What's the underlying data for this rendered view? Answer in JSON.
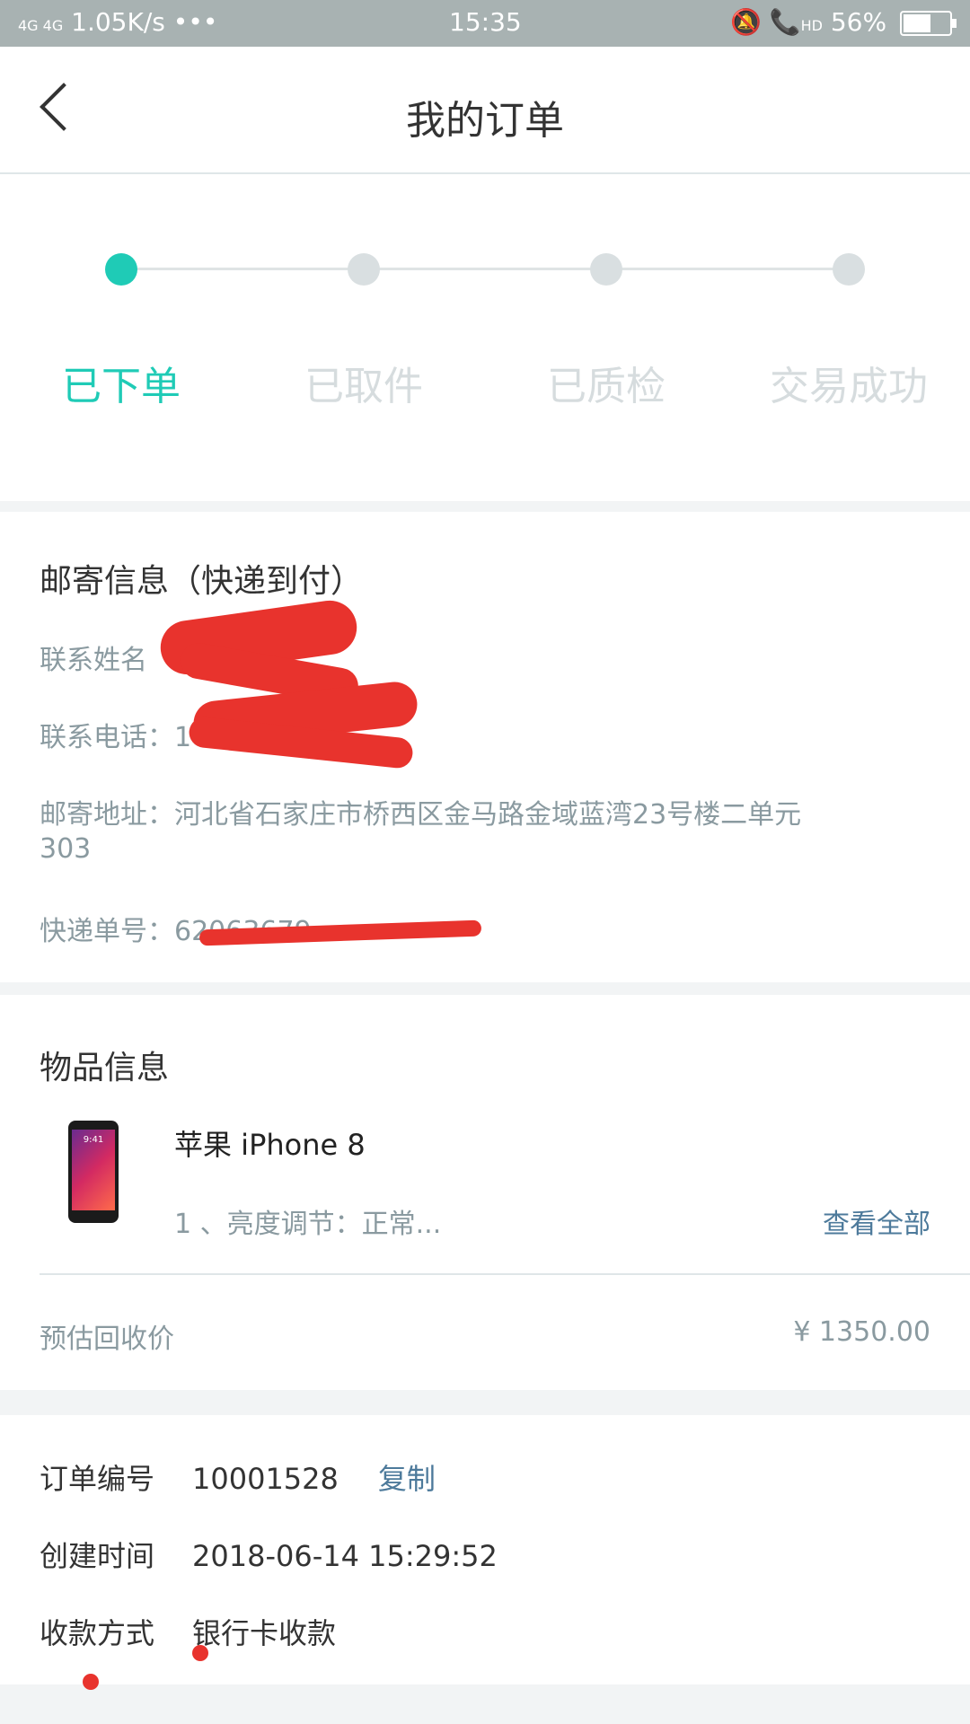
{
  "status_bar": {
    "signal": "4G 4G",
    "speed": "1.05K/s",
    "dots": "•••",
    "time": "15:35",
    "hd": "HD",
    "battery": "56%"
  },
  "nav": {
    "title": "我的订单"
  },
  "progress": {
    "steps": [
      {
        "label": "已下单",
        "active": true
      },
      {
        "label": "已取件",
        "active": false
      },
      {
        "label": "已质检",
        "active": false
      },
      {
        "label": "交易成功",
        "active": false
      }
    ]
  },
  "mailing": {
    "title": "邮寄信息（快递到付）",
    "name_label": "联系姓名",
    "phone_label": "联系电话",
    "phone_value": "1",
    "address_label": "邮寄地址",
    "address_value": "河北省石家庄市桥西区金马路金域蓝湾23号楼二单元",
    "address_line2": "303",
    "tracking_label": "快递单号",
    "tracking_value": "62063679",
    "separator": "："
  },
  "items": {
    "title": "物品信息",
    "phone_time": "9:41",
    "name": "苹果 iPhone 8",
    "desc": "1 、亮度调节：正常...",
    "view_all": "查看全部",
    "price_label": "预估回收价",
    "price_value": "¥ 1350.00"
  },
  "order": {
    "no_label": "订单编号",
    "no_value": "10001528",
    "copy_label": "复制",
    "time_label": "创建时间",
    "time_value": "2018-06-14 15:29:52",
    "payment_label": "收款方式",
    "payment_value": "银行卡收款"
  },
  "colors": {
    "accent": "#1fcbb6",
    "link": "#4d7a9b",
    "redaction": "#e8332d"
  }
}
